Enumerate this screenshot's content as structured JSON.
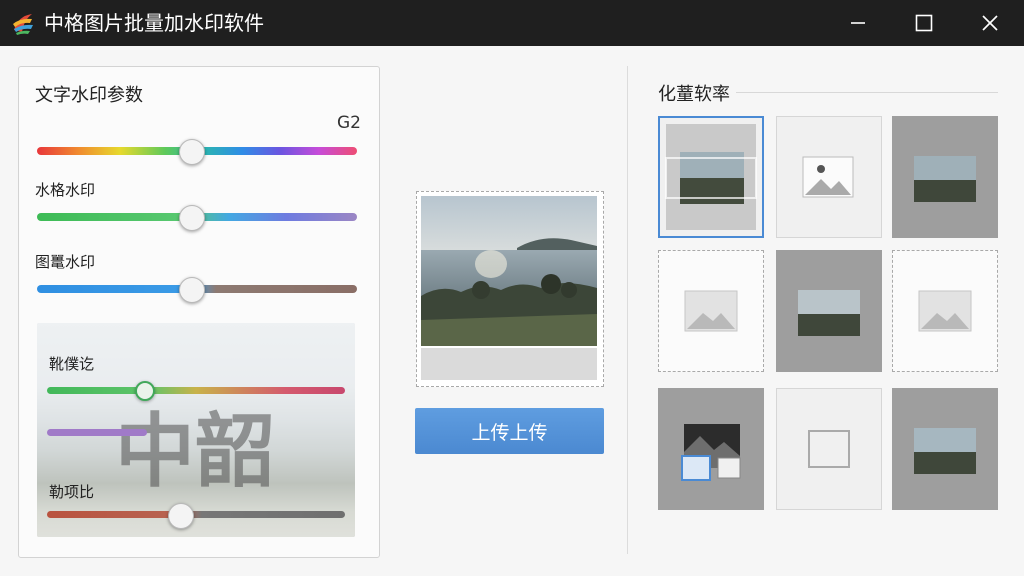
{
  "window": {
    "title": "中格图片批量加水印软件",
    "icon": "app-logo-icon",
    "controls": [
      "minimize-icon",
      "maximize-icon",
      "close-icon"
    ]
  },
  "left_panel": {
    "title": "文字水印参数",
    "value_readout": "G2",
    "sliders": [
      {
        "label": "",
        "value": 0.48
      },
      {
        "label": "水格水印",
        "value": 0.48
      },
      {
        "label": "图鼍水印",
        "value": 0.48
      }
    ],
    "preview": {
      "watermark_text": "中韶",
      "slider1_label": "靴僕讫",
      "slider1_value": 0.33,
      "slider2_label": "勒项比",
      "slider2_value": 0.45
    }
  },
  "center": {
    "upload_button_label": "上传上传"
  },
  "right_panel": {
    "title": "化蕫软率",
    "thumbnails": [
      {
        "style": "photo-selected"
      },
      {
        "style": "placeholder-light"
      },
      {
        "style": "photo-dark"
      },
      {
        "style": "placeholder-dashed"
      },
      {
        "style": "photo-dark"
      },
      {
        "style": "placeholder-dashed"
      },
      {
        "style": "photo-mixed"
      },
      {
        "style": "empty-frame"
      },
      {
        "style": "photo-dark"
      }
    ]
  },
  "colors": {
    "titlebar": "#1f1f1f",
    "accent": "#4a8ad4",
    "button": "#4b89d1"
  }
}
